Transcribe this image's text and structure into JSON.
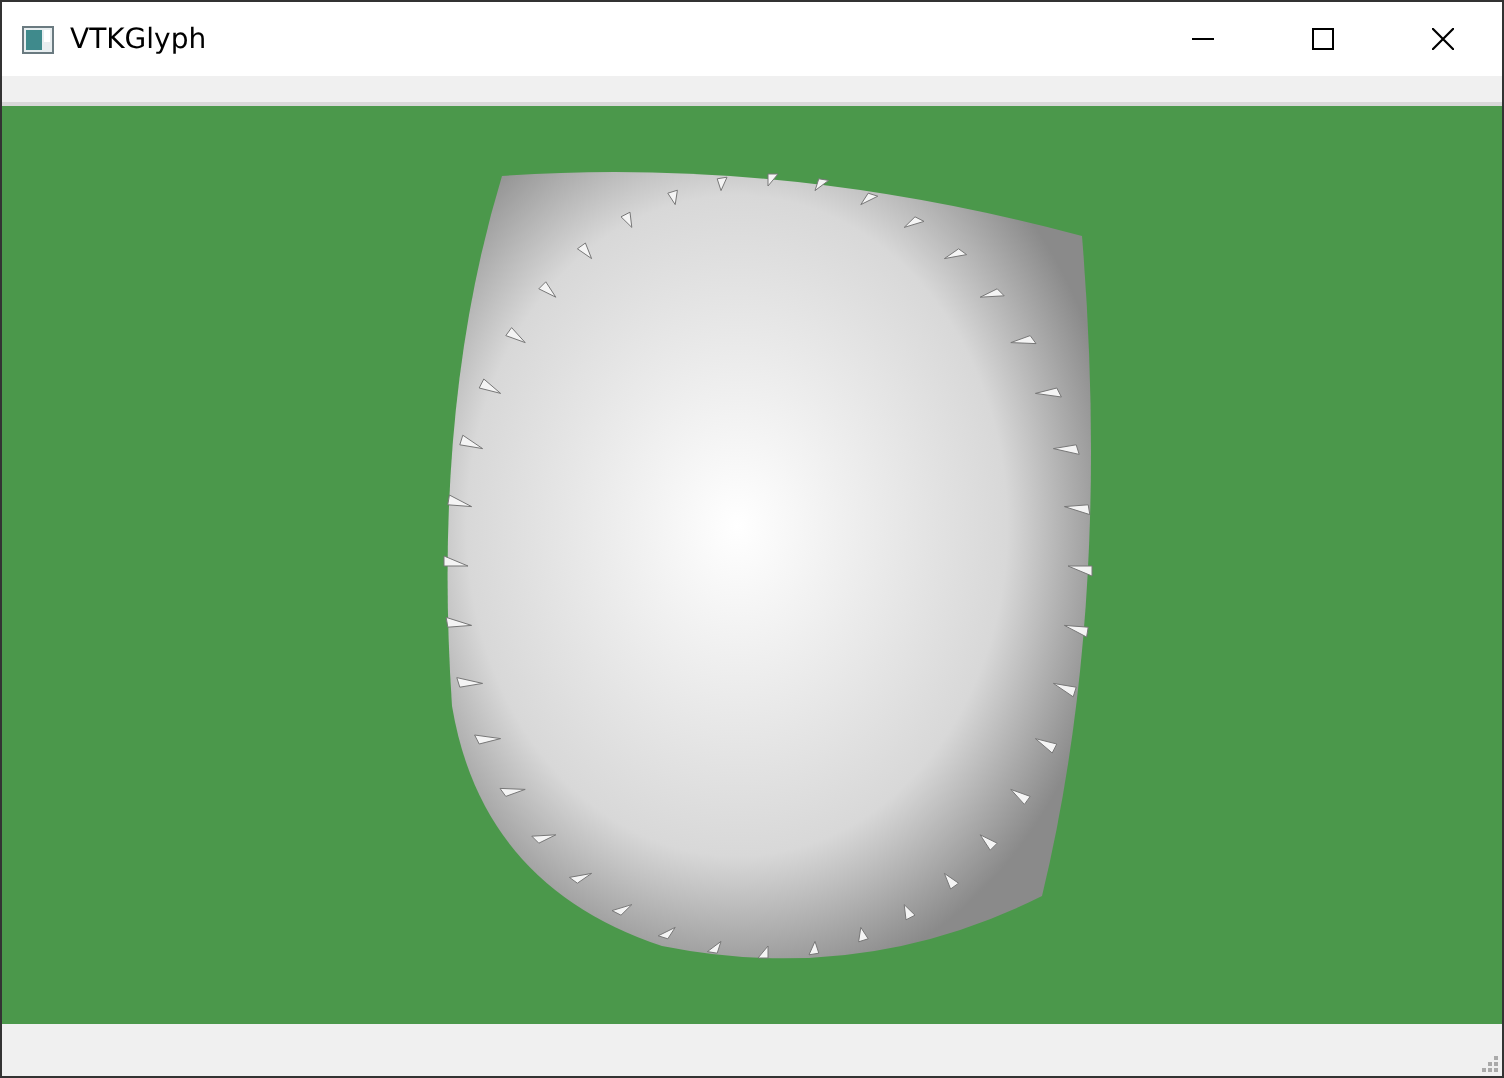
{
  "window": {
    "title": "VTKGlyph"
  }
}
